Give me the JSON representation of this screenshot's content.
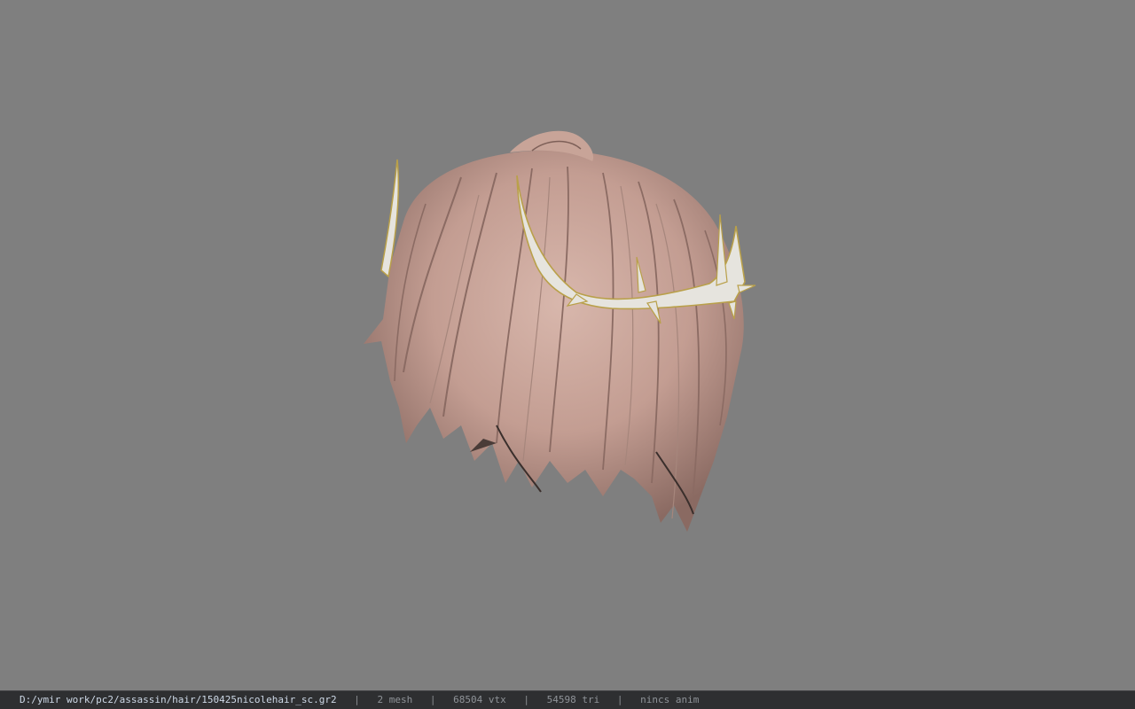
{
  "viewport": {
    "background": "#7f7f7f",
    "model": "hair-mesh-with-thorn-tiara",
    "hair_color": "#c9a69c",
    "tiara_color": "#e6e4de",
    "tiara_trim_color": "#b9a04a"
  },
  "statusbar": {
    "file_path": "D:/ymir work/pc2/assassin/hair/150425nicolehair_sc.gr2",
    "separator": "|",
    "mesh_count": "2 mesh",
    "vertex_count": "68504 vtx",
    "triangle_count": "54598 tri",
    "anim_status": "nincs anim"
  }
}
